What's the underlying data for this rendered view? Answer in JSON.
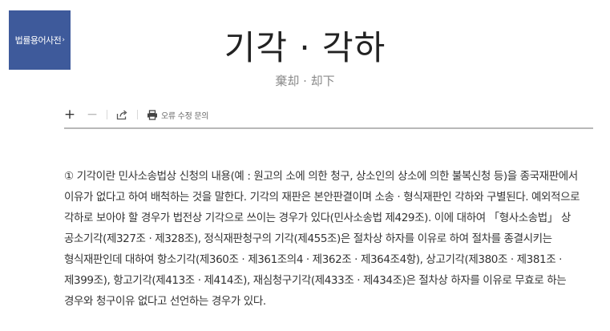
{
  "side_tab": {
    "label": "법률용어사전",
    "arrow": "›"
  },
  "entry": {
    "title": "기각 · 각하",
    "hanja": "棄却 · 却下"
  },
  "toolbar": {
    "zoom_in": "+",
    "zoom_out": "−",
    "report_label": "오류 수정 문의",
    "icons": [
      "plus-icon",
      "minus-icon",
      "share-icon",
      "print-icon"
    ]
  },
  "content": {
    "paragraph": "① 기각이란 민사소송법상 신청의 내용(예 : 원고의 소에 의한 청구, 상소인의 상소에 의한 불복신청 등)을 종국재판에서 이유가 없다고 하여 배척하는 것을 말한다. 기각의 재판은 본안판결이며 소송 · 형식재판인 각하와 구별된다. 예외적으로 각하로 보아야 할 경우가 법전상 기각으로 쓰이는 경우가 있다(민사소송법 제429조). 이에 대하여 「형사소송법」 상 공소기각(제327조 · 제328조), 정식재판청구의 기각(제455조)은 절차상 하자를 이유로 하여 절차를 종결시키는 형식재판인데 대하여 항소기각(제360조 · 제361조의4 · 제362조 · 제364조4항), 상고기각(제380조 · 제381조 · 제399조), 항고기각(제413조 · 제414조), 재심청구기각(제433조 · 제434조)은 절차상 하자를 이유로 무효로 하는 경우와 청구이유 없다고 선언하는 경우가 있다."
  }
}
